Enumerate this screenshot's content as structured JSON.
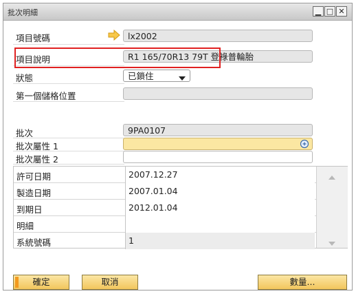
{
  "window": {
    "title": "批次明細",
    "controls": {
      "minimize": "▁",
      "maximize": "□",
      "close": "✕"
    }
  },
  "header_fields": [
    {
      "label": "項目號碼",
      "value": "lx2002",
      "icon": "link-arrow-icon"
    },
    {
      "label": "項目說明",
      "value": "R1 165/70R13 79T 登祿普輪胎"
    },
    {
      "label": "狀態",
      "value": "已鎖住",
      "type": "dropdown"
    },
    {
      "label": "第一個儲格位置",
      "value": ""
    }
  ],
  "batch_fields": [
    {
      "label": "批次",
      "value": "9PA0107"
    },
    {
      "label": "批次屬性 1",
      "value": ""
    },
    {
      "label": "批次屬性 2",
      "value": ""
    }
  ],
  "grid_rows": [
    {
      "label": "許可日期",
      "value": "2007.12.27"
    },
    {
      "label": "製造日期",
      "value": "2007.01.04"
    },
    {
      "label": "到期日",
      "value": "2012.01.04"
    },
    {
      "label": "明細",
      "value": ""
    },
    {
      "label": "系統號碼",
      "value": "1"
    }
  ],
  "buttons": {
    "ok": "確定",
    "cancel": "取消",
    "quantity": "數量..."
  },
  "colors": {
    "highlight": "#e02020",
    "button_fill": "#f2c65c",
    "button_edge": "#f39a1e",
    "yellow_field": "#fbe7a2"
  }
}
